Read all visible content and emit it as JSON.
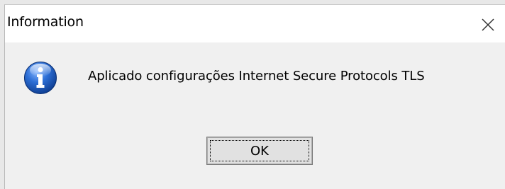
{
  "window": {
    "title": "Information",
    "close_icon": "close-icon"
  },
  "dialog": {
    "icon": "information-icon",
    "message": "Aplicado configurações Internet Secure Protocols TLS",
    "ok_label": "OK"
  },
  "colors": {
    "titlebar_bg": "#ffffff",
    "body_bg": "#f0f0f0",
    "icon_blue": "#1f5fc4",
    "button_bg": "#e1e1e1"
  }
}
